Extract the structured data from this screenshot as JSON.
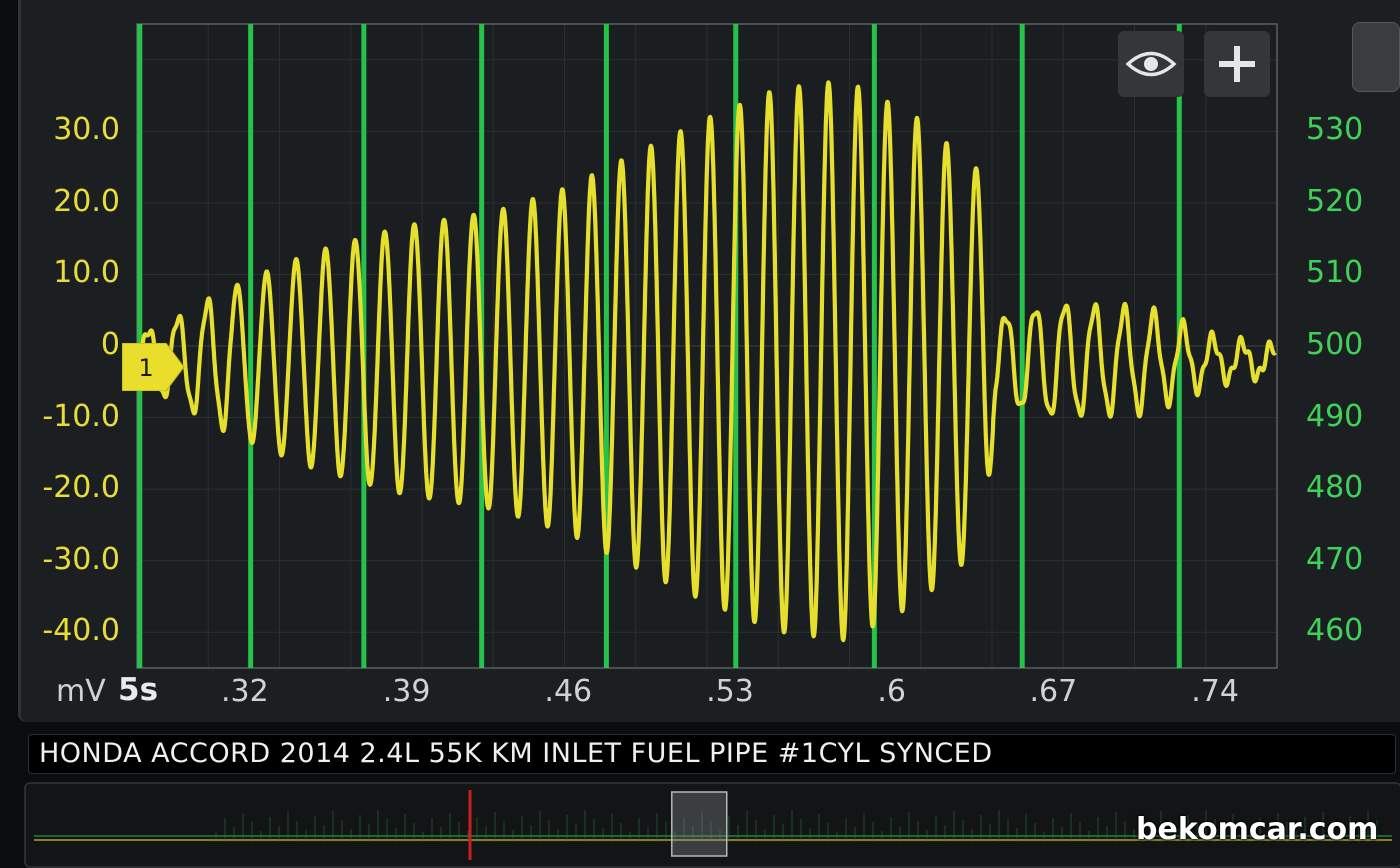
{
  "chart_data": {
    "type": "line",
    "title": "HONDA ACCORD 2014 2.4L 55K KM INLET FUEL PIPE #1CYL SYNCED",
    "left_axis": {
      "unit": "mV",
      "ticks": [
        "30.0",
        "20.0",
        "10.0",
        "0",
        "-10.0",
        "-20.0",
        "-30.0",
        "-40.0"
      ],
      "ylim": [
        -45,
        45
      ]
    },
    "right_axis": {
      "ticks": [
        "530",
        "520",
        "510",
        "500",
        "490",
        "480",
        "470",
        "460"
      ],
      "ylim": [
        455,
        545
      ]
    },
    "x_axis": {
      "time_window": "5s",
      "ticks": [
        ".32",
        ".39",
        ".46",
        ".53",
        ".6",
        ".67",
        ".74"
      ],
      "xlim": [
        0.2733,
        0.7668
      ]
    },
    "grid": true,
    "series": [
      {
        "color": "#e6df2e",
        "description": "oscillating pressure pulsation",
        "envelope_x": [
          0.275,
          0.29,
          0.32,
          0.35,
          0.39,
          0.43,
          0.46,
          0.49,
          0.52,
          0.55,
          0.58,
          0.61,
          0.64,
          0.645,
          0.67,
          0.71,
          0.74,
          0.766
        ],
        "envelope_amp": [
          4,
          6,
          11,
          15,
          19,
          21,
          24,
          29,
          34,
          38,
          39,
          34,
          26,
          6,
          8,
          7,
          3,
          2
        ],
        "oscillation_period": 0.0128
      }
    ],
    "sync_markers_x": [
      0.2745,
      0.3225,
      0.3715,
      0.4225,
      0.4765,
      0.5325,
      0.5925,
      0.6565,
      0.7245
    ],
    "marker_color": "#27c24a",
    "cursor": {
      "label": "1",
      "value": -3
    }
  },
  "toolbar": {
    "eye_icon": "eye-icon",
    "plus_icon": "plus-icon"
  },
  "overview": {
    "window_start": 0.47,
    "window_end": 0.51
  },
  "watermark": "bekomcar.com"
}
